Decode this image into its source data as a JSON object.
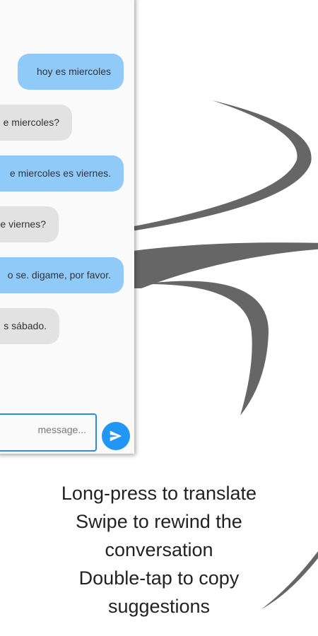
{
  "chat": {
    "messages": [
      {
        "type": "sent",
        "text": "hoy es miercoles"
      },
      {
        "type": "received",
        "text": "e miercoles?"
      },
      {
        "type": "sent",
        "text": "e miercoles es viernes."
      },
      {
        "type": "received",
        "text": "e viernes?"
      },
      {
        "type": "sent",
        "text": "o se. digame, por favor."
      },
      {
        "type": "received",
        "text": "s sábado."
      }
    ],
    "input_placeholder": "message...",
    "send_icon": "send-icon"
  },
  "caption": {
    "lines": [
      "Long-press to translate",
      "Swipe to rewind the",
      "conversation",
      "Double-tap to copy",
      "suggestions"
    ]
  },
  "colors": {
    "sent_bubble": "#90caf9",
    "received_bubble": "#e2e2e2",
    "accent": "#2196f3",
    "swoosh": "#666666"
  }
}
